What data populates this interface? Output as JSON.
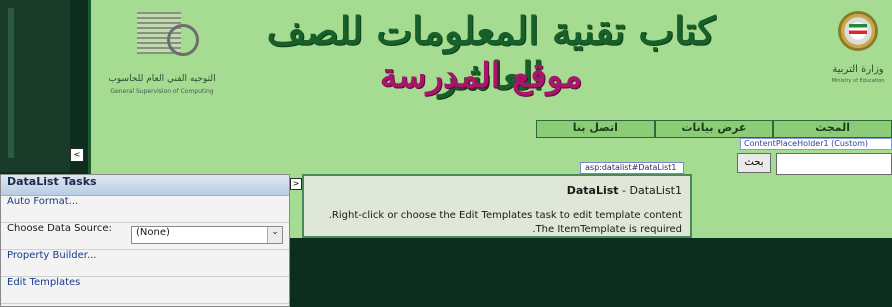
{
  "header": {
    "title_main": "كتاب تقنية المعلومات للصف العاشر",
    "title_sub": "موقع المدرسة",
    "left_logo_text": "التوجيه الفني العام للحاسوب",
    "left_logo_sub": "General Supervision of Computing",
    "right_logo_text": "وزارة التربية",
    "right_logo_sub": "Ministry of Education"
  },
  "nav": {
    "tabs": [
      {
        "label": "المجث"
      },
      {
        "label": "عرض بيانات"
      },
      {
        "label": "اتصل بنا"
      }
    ]
  },
  "designer": {
    "content_placeholder_tag": "ContentPlaceHolder1 (Custom)",
    "datalist_tag": "asp:datalist#DataList1",
    "collapse_glyph": "<",
    "expand_glyph": ">"
  },
  "search": {
    "button_label": "بحث",
    "input_value": ""
  },
  "datalist": {
    "head_bold": "DataList",
    "head_rest": " - DataList1",
    "line1": "Right-click or choose the Edit Templates task to edit template content.",
    "line2": "The ItemTemplate is required."
  },
  "tasks": {
    "header": "DataList Tasks",
    "auto_format": "Auto Format...",
    "data_source_label": "Choose Data Source:",
    "data_source_value": "(None)",
    "property_builder": "Property Builder...",
    "edit_templates": "Edit Templates"
  }
}
